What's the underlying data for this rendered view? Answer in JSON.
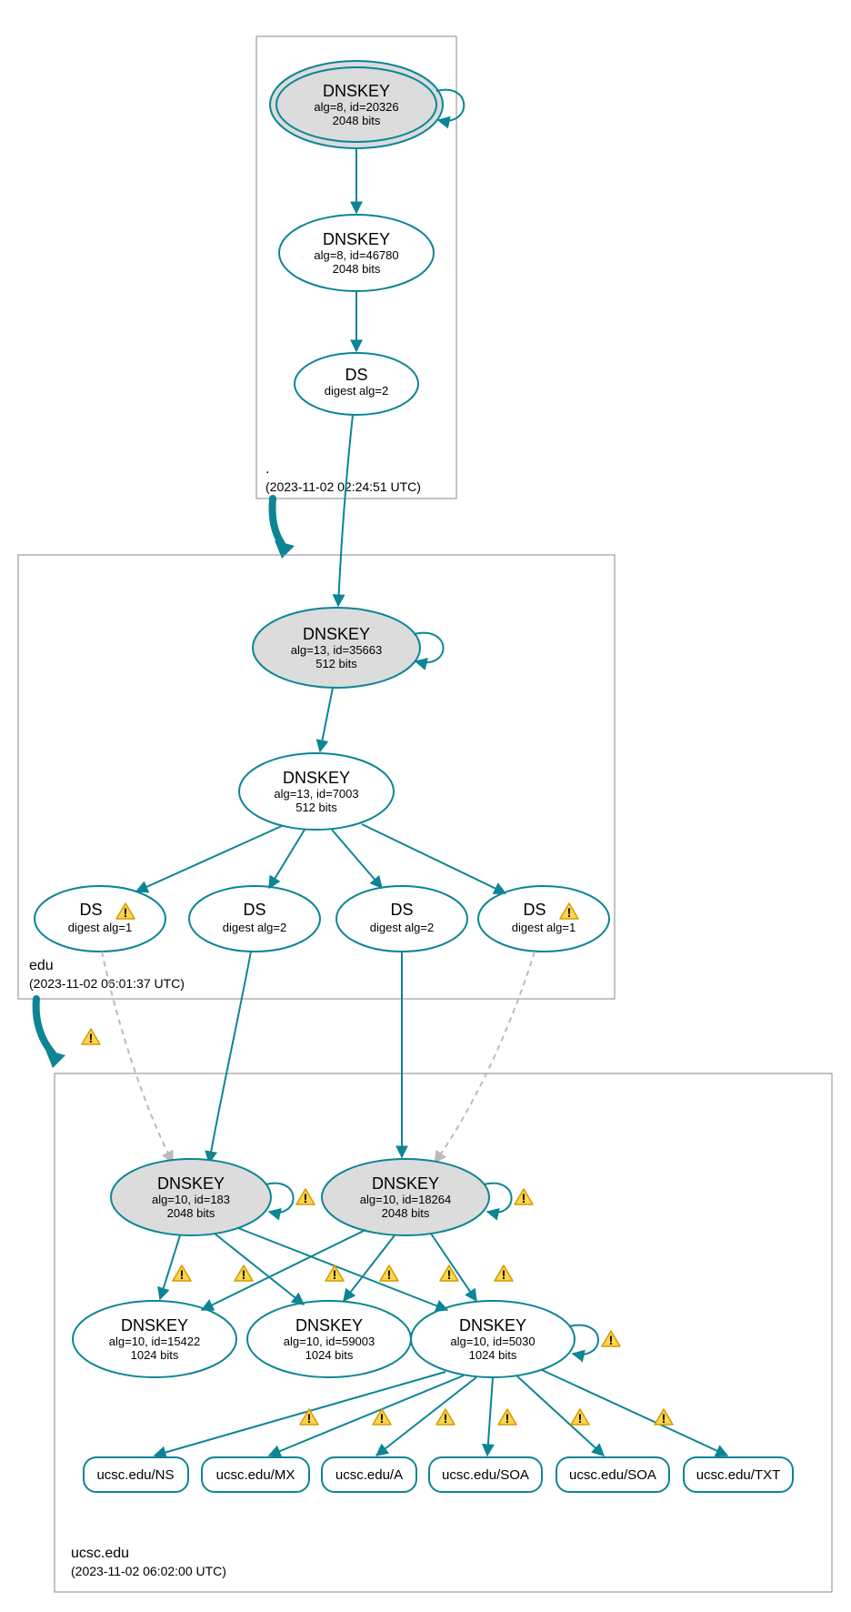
{
  "zones": {
    "root": {
      "label": ".",
      "timestamp": "(2023-11-02 02:24:51 UTC)"
    },
    "edu": {
      "label": "edu",
      "timestamp": "(2023-11-02 06:01:37 UTC)"
    },
    "ucsc": {
      "label": "ucsc.edu",
      "timestamp": "(2023-11-02 06:02:00 UTC)"
    }
  },
  "nodes": {
    "root_ksk": {
      "title": "DNSKEY",
      "line2": "alg=8, id=20326",
      "line3": "2048 bits"
    },
    "root_zsk": {
      "title": "DNSKEY",
      "line2": "alg=8, id=46780",
      "line3": "2048 bits"
    },
    "root_ds": {
      "title": "DS",
      "line2": "digest alg=2"
    },
    "edu_ksk": {
      "title": "DNSKEY",
      "line2": "alg=13, id=35663",
      "line3": "512 bits"
    },
    "edu_zsk": {
      "title": "DNSKEY",
      "line2": "alg=13, id=7003",
      "line3": "512 bits"
    },
    "edu_ds1": {
      "title": "DS",
      "line2": "digest alg=1"
    },
    "edu_ds2": {
      "title": "DS",
      "line2": "digest alg=2"
    },
    "edu_ds3": {
      "title": "DS",
      "line2": "digest alg=2"
    },
    "edu_ds4": {
      "title": "DS",
      "line2": "digest alg=1"
    },
    "ucsc_ksk1": {
      "title": "DNSKEY",
      "line2": "alg=10, id=183",
      "line3": "2048 bits"
    },
    "ucsc_ksk2": {
      "title": "DNSKEY",
      "line2": "alg=10, id=18264",
      "line3": "2048 bits"
    },
    "ucsc_zsk1": {
      "title": "DNSKEY",
      "line2": "alg=10, id=15422",
      "line3": "1024 bits"
    },
    "ucsc_zsk2": {
      "title": "DNSKEY",
      "line2": "alg=10, id=59003",
      "line3": "1024 bits"
    },
    "ucsc_zsk3": {
      "title": "DNSKEY",
      "line2": "alg=10, id=5030",
      "line3": "1024 bits"
    }
  },
  "rrsets": {
    "ns": "ucsc.edu/NS",
    "mx": "ucsc.edu/MX",
    "a": "ucsc.edu/A",
    "soa1": "ucsc.edu/SOA",
    "soa2": "ucsc.edu/SOA",
    "txt": "ucsc.edu/TXT"
  },
  "colors": {
    "teal": "#0d8594",
    "shade": "#dcdcdc",
    "warn_fill": "#ffd54a",
    "warn_stroke": "#d69a00"
  }
}
